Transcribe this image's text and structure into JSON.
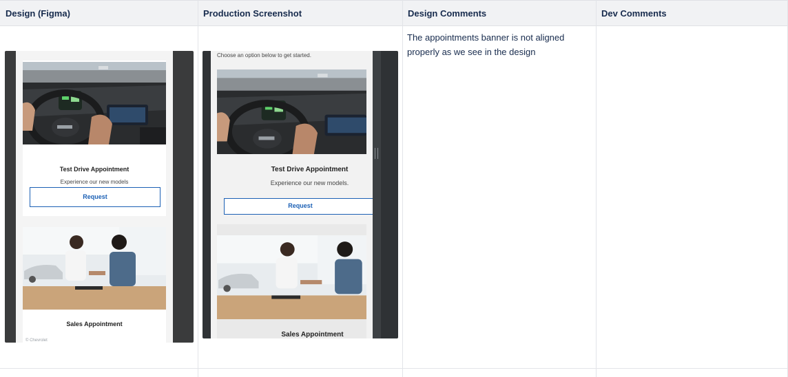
{
  "table": {
    "headers": [
      "Design (Figma)",
      "Production Screenshot",
      "Design Comments",
      "Dev Comments"
    ],
    "row": {
      "design_comment": "The appointments banner is not aligned properly as we see in the design",
      "dev_comment": ""
    }
  },
  "figma": {
    "test_drive_title": "Test Drive Appointment",
    "test_drive_sub": "Experience our new models",
    "request_label": "Request",
    "sales_title_partial": "Sales Appointment",
    "footer_partial": "© Chevrolet"
  },
  "production": {
    "intro": "Choose an option below to get started.",
    "test_drive_title": "Test Drive Appointment",
    "test_drive_sub": "Experience our new models.",
    "request_label": "Request",
    "sales_title": "Sales Appointment"
  },
  "icons": {
    "chat": "chat-bubble-icon",
    "grip": "drag-handle-icon"
  },
  "colors": {
    "accent": "#1a5fb4",
    "chat": "#2a73d6",
    "header_bg": "#f1f2f4"
  }
}
